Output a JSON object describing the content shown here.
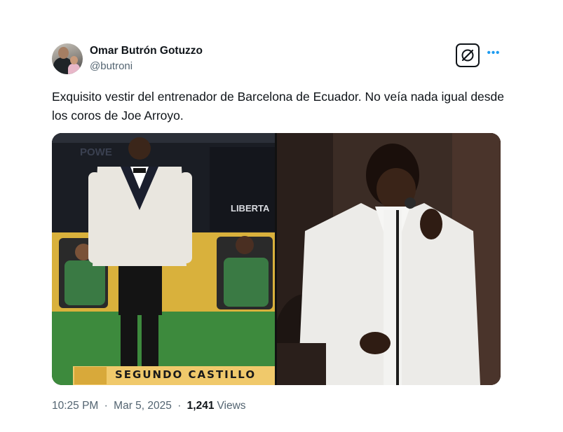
{
  "author": {
    "name": "Omar Butrón Gotuzzo",
    "handle": "@butroni",
    "avatar_icon": "profile-photo"
  },
  "actions": {
    "grok_icon": "grok-icon",
    "more_label": "•••"
  },
  "tweet": {
    "text": "Exquisito vestir del entrenador de Barcelona de Ecuador. No veía nada igual desde los coros de Joe Arroyo."
  },
  "media": {
    "left_image": {
      "caption": "SEGUNDO CASTILLO",
      "background_text_1": "POWE",
      "background_text_2": "LIBERTA"
    }
  },
  "meta": {
    "time": "10:25 PM",
    "separator": "·",
    "date": "Mar 5, 2025",
    "views_count": "1,241",
    "views_label": "Views"
  },
  "colors": {
    "text": "#0f1419",
    "muted": "#536471",
    "accent": "#1d9bf0"
  }
}
